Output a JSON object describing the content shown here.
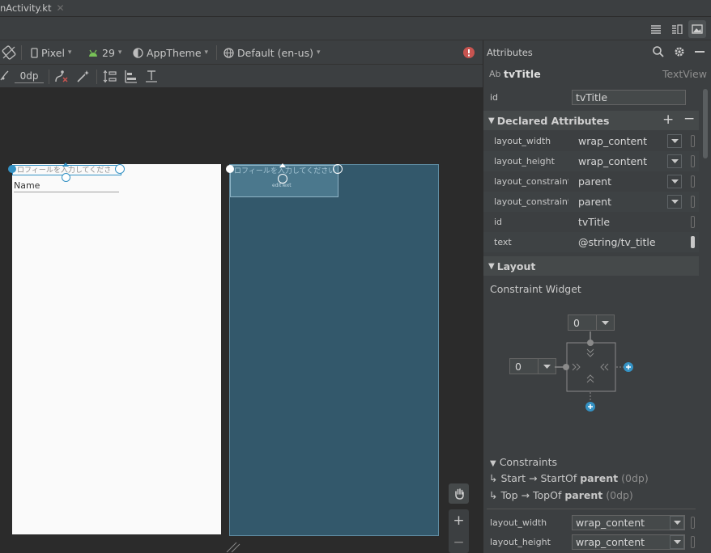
{
  "tab": {
    "title": "nActivity.kt",
    "close": "✕"
  },
  "toolbar": {
    "device": "Pixel",
    "api": "29",
    "theme": "AppTheme",
    "locale": "Default (en-us)",
    "margin": "0dp"
  },
  "design": {
    "text_view": "ロフィールを入力してくださ",
    "edit_label": "Name"
  },
  "blueprint": {
    "text_view": "ロフィールを入力してください",
    "edit_label": "editText"
  },
  "attributes": {
    "panel_title": "Attributes",
    "component_prefix": "Ab",
    "component_name": "tvTitle",
    "component_type": "TextView",
    "id_label": "id",
    "id_value": "tvTitle",
    "declared_title": "Declared Attributes",
    "declared": [
      {
        "key": "layout_width",
        "value": "wrap_content",
        "dropdown": true
      },
      {
        "key": "layout_height",
        "value": "wrap_content",
        "dropdown": true
      },
      {
        "key": "layout_constraint...",
        "value": "parent",
        "dropdown": true
      },
      {
        "key": "layout_constraint...",
        "value": "parent",
        "dropdown": true
      },
      {
        "key": "id",
        "value": "tvTitle",
        "dropdown": false
      },
      {
        "key": "text",
        "value": "@string/tv_title",
        "dropdown": false
      }
    ],
    "layout_title": "Layout",
    "constraint_widget": "Constraint Widget",
    "top_margin": "0",
    "start_margin": "0",
    "constraints_title": "Constraints",
    "constraint_start": {
      "arrow_from": "Start",
      "arrow": "→",
      "target": "StartOf",
      "parent": "parent",
      "margin": "(0dp)"
    },
    "constraint_top": {
      "arrow_from": "Top",
      "arrow": "→",
      "target": "TopOf",
      "parent": "parent",
      "margin": "(0dp)"
    },
    "bottom_rows": [
      {
        "key": "layout_width",
        "value": "wrap_content"
      },
      {
        "key": "layout_height",
        "value": "wrap_content"
      }
    ]
  },
  "colors": {
    "accent": "#3592c4",
    "error": "#c75450",
    "android": "#78c257"
  }
}
